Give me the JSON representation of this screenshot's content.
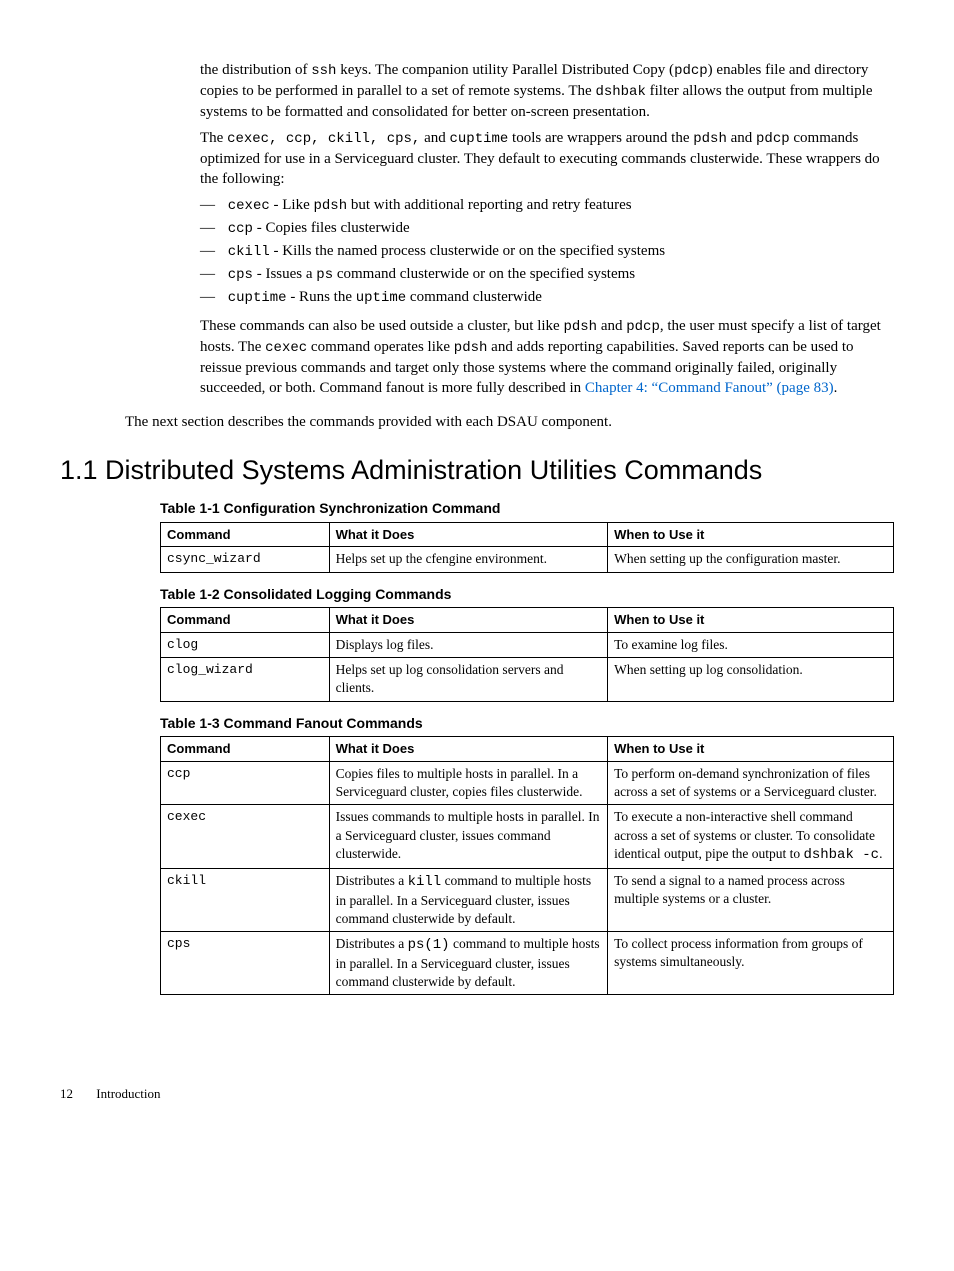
{
  "intro_para1_pre": "the distribution of ",
  "intro_para1_code1": "ssh",
  "intro_para1_mid1": " keys. The companion utility Parallel Distributed Copy (",
  "intro_para1_code2": "pdcp",
  "intro_para1_mid2": ") enables file and directory copies to be performed in parallel to a set of remote systems. The ",
  "intro_para1_code3": "dshbak",
  "intro_para1_post": " filter allows the output from multiple systems to be formatted and consolidated for better on-screen presentation.",
  "para2_pre": "The ",
  "para2_code1": "cexec, ccp, ckill, cps,",
  "para2_mid1": " and ",
  "para2_code2": "cuptime",
  "para2_mid2": " tools are wrappers around the ",
  "para2_code3": "pdsh",
  "para2_mid3": " and ",
  "para2_code4": "pdcp",
  "para2_post": " commands optimized for use in a Serviceguard cluster. They default to executing commands clusterwide. These wrappers do the following:",
  "cmd_list": {
    "i0_code": "cexec",
    "i0_mid": " - Like ",
    "i0_code2": "pdsh",
    "i0_post": " but with additional reporting and retry features",
    "i1_code": "ccp",
    "i1_post": " - Copies files clusterwide",
    "i2_code": "ckill",
    "i2_post": " - Kills the named process clusterwide or on the specified systems",
    "i3_code": "cps",
    "i3_mid": " - Issues a ",
    "i3_code2": "ps",
    "i3_post": " command clusterwide or on the specified systems",
    "i4_code": "cuptime",
    "i4_mid": " - Runs the ",
    "i4_code2": "uptime",
    "i4_post": " command clusterwide"
  },
  "para3_pre": "These commands can also be used outside a cluster, but like ",
  "para3_code1": "pdsh",
  "para3_mid1": " and ",
  "para3_code2": "pdcp",
  "para3_mid2": ", the user must specify a list of target hosts. The ",
  "para3_code3": "cexec",
  "para3_mid3": " command operates like ",
  "para3_code4": "pdsh",
  "para3_post": " and adds reporting capabilities. Saved reports can be used to reissue previous commands and target only those systems where the command originally failed, originally succeeded, or both. Command fanout is more fully described in ",
  "para3_link": "Chapter 4: “Command Fanout” (page 83)",
  "para3_dot": ".",
  "next_section": "The next section describes the commands provided with each DSAU component.",
  "section_heading": "1.1 Distributed Systems Administration Utilities Commands",
  "tables": {
    "t1_title": "Table 1-1 Configuration Synchronization Command",
    "t2_title": "Table 1-2 Consolidated Logging Commands",
    "t3_title": "Table 1-3 Command Fanout Commands",
    "headers": {
      "c1": "Command",
      "c2": "What it Does",
      "c3": "When to Use it"
    },
    "t1": {
      "r0": {
        "cmd": "csync_wizard",
        "does": "Helps set up the cfengine environment.",
        "when": "When setting up the configuration master."
      }
    },
    "t2": {
      "r0": {
        "cmd": "clog",
        "does": "Displays log files.",
        "when": "To examine log files."
      },
      "r1": {
        "cmd": "clog_wizard",
        "does": "Helps set up log consolidation servers and clients.",
        "when": "When setting up log consolidation."
      }
    },
    "t3": {
      "r0": {
        "cmd": "ccp",
        "does": "Copies files to multiple hosts in parallel. In a Serviceguard cluster, copies files clusterwide.",
        "when": "To perform on-demand synchronization of files across a set of systems or a Serviceguard cluster."
      },
      "r1": {
        "cmd": "cexec",
        "does": "Issues commands to multiple hosts in parallel. In a Serviceguard cluster, issues command clusterwide.",
        "when_pre": "To execute a non-interactive shell command across a set of systems or cluster. To consolidate identical output, pipe the output to ",
        "when_code": "dshbak -c",
        "when_post": "."
      },
      "r2": {
        "cmd": "ckill",
        "does_pre": "Distributes a ",
        "does_code": "kill",
        "does_post": " command to multiple hosts in parallel. In a Serviceguard cluster, issues command clusterwide by default.",
        "when": "To send a signal to a named process across multiple systems or a cluster."
      },
      "r3": {
        "cmd": "cps",
        "does_pre": "Distributes a ",
        "does_code": "ps(1)",
        "does_post": " command to multiple hosts in parallel. In a Serviceguard cluster, issues command clusterwide by default.",
        "when": "To collect process information from groups of systems simultaneously."
      }
    }
  },
  "footer_page": "12",
  "footer_label": "Introduction"
}
